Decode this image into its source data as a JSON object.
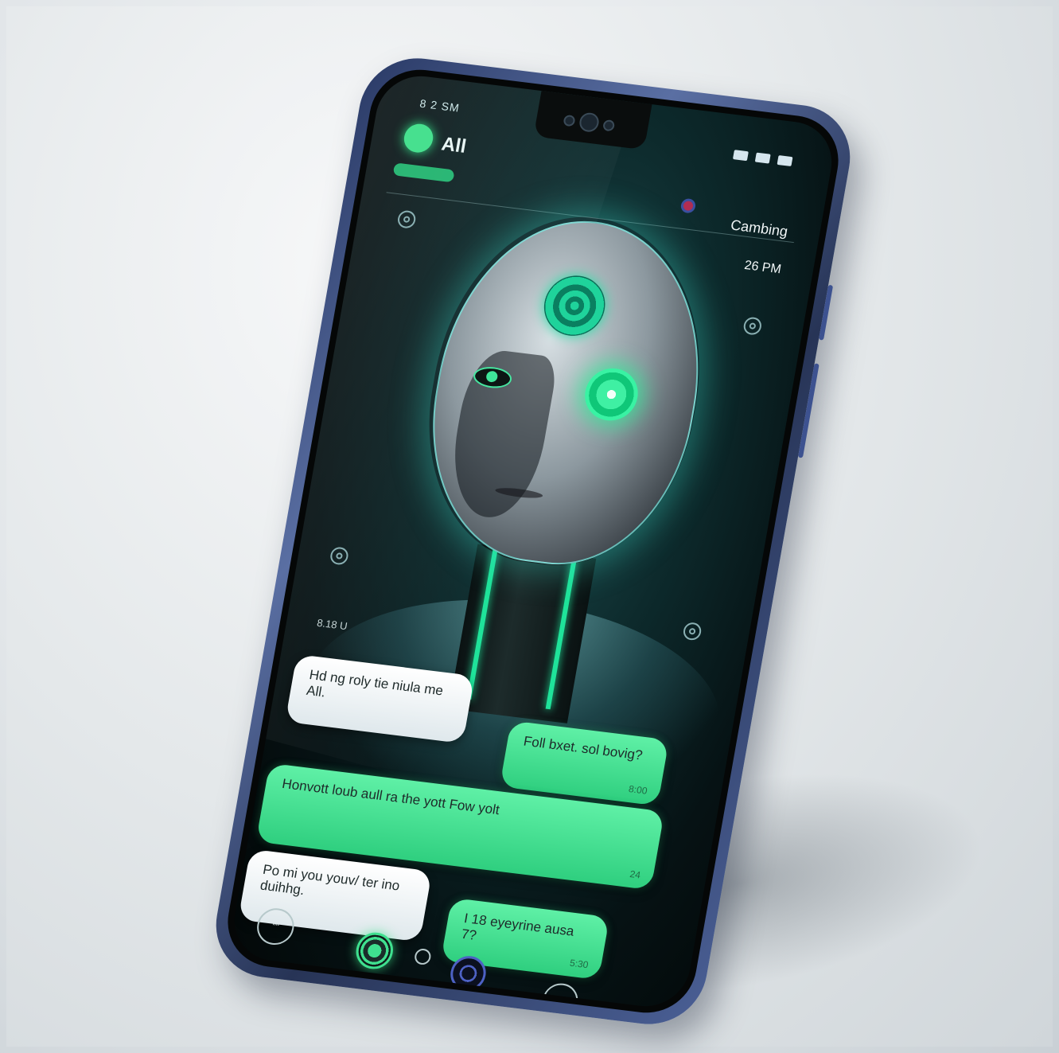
{
  "status_bar": {
    "left_text": "8 2 SM",
    "right_icons": [
      "signal-icon",
      "wifi-icon",
      "battery-icon"
    ]
  },
  "header": {
    "app_name": "All",
    "status": "Cambing",
    "time": "26 PM"
  },
  "chat": {
    "timestamp": "8.18 U",
    "messages": [
      {
        "side": "left",
        "text": "Hd ng roly tie niula me All.",
        "meta": ""
      },
      {
        "side": "right",
        "text": "Foll bxet. sol bovig?",
        "meta": "8:00"
      },
      {
        "side": "right",
        "text": "Honvott loub aull ra the yott Fow yolt",
        "meta": "24"
      },
      {
        "side": "left",
        "text": "Po mi you youv/ ter ino duihhg.",
        "meta": ""
      },
      {
        "side": "right",
        "text": "I 18 eyeyrine ausa 7?",
        "meta": "5:30"
      }
    ]
  },
  "nav": {
    "left_label": "\"\""
  },
  "colors": {
    "accent_green": "#3fe08f",
    "phone_frame": "#3d5290",
    "screen_bg": "#061214"
  }
}
